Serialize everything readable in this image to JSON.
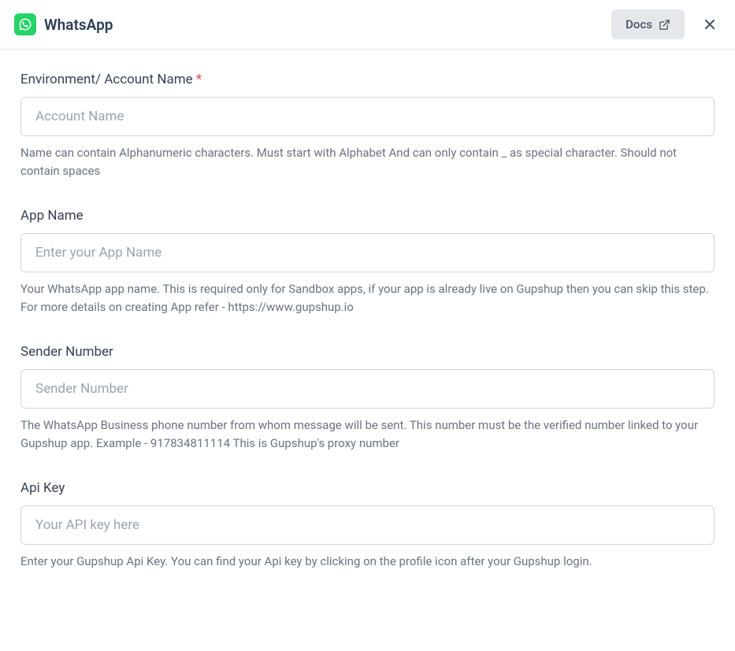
{
  "header": {
    "title": "WhatsApp",
    "docs_label": "Docs"
  },
  "form": {
    "account_name": {
      "label": "Environment/ Account Name",
      "required_marker": "*",
      "placeholder": "Account Name",
      "value": "",
      "help": "Name can contain Alphanumeric characters. Must start with Alphabet And can only contain _ as special character. Should not contain spaces"
    },
    "app_name": {
      "label": "App Name",
      "placeholder": "Enter your App Name",
      "value": "",
      "help": "Your WhatsApp app name. This is required only for Sandbox apps, if your app is already live on Gupshup then you can skip this step. For more details on creating App refer - https://www.gupshup.io"
    },
    "sender_number": {
      "label": "Sender Number",
      "placeholder": "Sender Number",
      "value": "",
      "help": "The WhatsApp Business phone number from whom message will be sent. This number must be the verified number linked to your Gupshup app. Example - 917834811114 This is Gupshup's proxy number"
    },
    "api_key": {
      "label": "Api Key",
      "placeholder": "Your API key here",
      "value": "",
      "help": "Enter your Gupshup Api Key. You can find your Api key by clicking on the profile icon after your Gupshup login."
    }
  }
}
